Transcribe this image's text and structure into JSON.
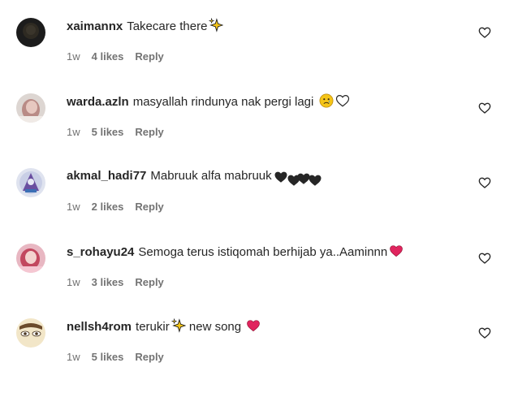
{
  "comments": [
    {
      "username": "xaimannx",
      "text": "Takecare there",
      "time": "1w",
      "likes": "4 likes",
      "reply": "Reply",
      "emojis": [
        "sparkles"
      ]
    },
    {
      "username": "warda.azln",
      "text": "masyallah rindunya nak pergi lagi",
      "time": "1w",
      "likes": "5 likes",
      "reply": "Reply",
      "emojis": [
        "sad-face",
        "white-heart"
      ]
    },
    {
      "username": "akmal_hadi77",
      "text": "Mabruuk alfa mabruuk",
      "time": "1w",
      "likes": "2 likes",
      "reply": "Reply",
      "emojis": [
        "black-heart",
        "black-heart",
        "black-heart",
        "black-heart"
      ]
    },
    {
      "username": "s_rohayu24",
      "text": "Semoga terus istiqomah berhijab ya..Aaminnn",
      "time": "1w",
      "likes": "3 likes",
      "reply": "Reply",
      "emojis": [
        "red-heart"
      ]
    },
    {
      "username": "nellsh4rom",
      "text": "terukir",
      "text2": "new song",
      "time": "1w",
      "likes": "5 likes",
      "reply": "Reply",
      "emojis": [
        "sparkles",
        "red-heart"
      ]
    }
  ],
  "colors": {
    "text": "#262626",
    "meta": "#737373",
    "red_heart": "#e0245e"
  }
}
